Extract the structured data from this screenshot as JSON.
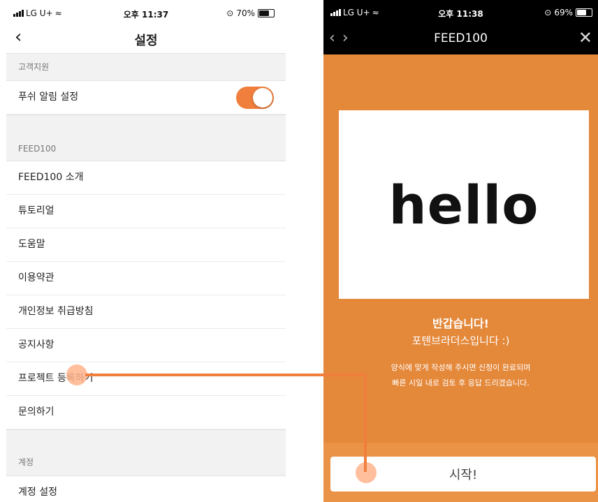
{
  "left_screen": {
    "status": {
      "carrier": "LG U+",
      "time": "오후 11:37",
      "battery": "70%"
    },
    "title": "설정",
    "sections": [
      {
        "header": "고객지원",
        "items": [
          {
            "label": "푸쉬 알림 설정",
            "toggle": true
          }
        ]
      },
      {
        "header": "FEED100",
        "items": [
          {
            "label": "FEED100 소개"
          },
          {
            "label": "튜토리얼"
          },
          {
            "label": "도움말"
          },
          {
            "label": "이용약관"
          },
          {
            "label": "개인정보 취급방침"
          },
          {
            "label": "공지사항"
          },
          {
            "label": "프로젝트 등록하기"
          },
          {
            "label": "문의하기"
          }
        ]
      },
      {
        "header": "계정",
        "items": [
          {
            "label": "계정 설정"
          }
        ]
      }
    ]
  },
  "right_screen": {
    "status": {
      "carrier": "LG U+",
      "time": "오후 11:38",
      "battery": "69%"
    },
    "title": "FEED100",
    "hello": "hello",
    "greeting": "반갑습니다!",
    "greeting_sub": "포텐브라더스입니다 :)",
    "description_1": "양식에 맞게 작성해 주시면 신청이 완료되며",
    "description_2": "빠른 시일 내로 검토 후 응답 드리겠습니다.",
    "start_button": "시작!"
  },
  "colors": {
    "accent": "#f07e3c",
    "panel": "#e4883a"
  }
}
